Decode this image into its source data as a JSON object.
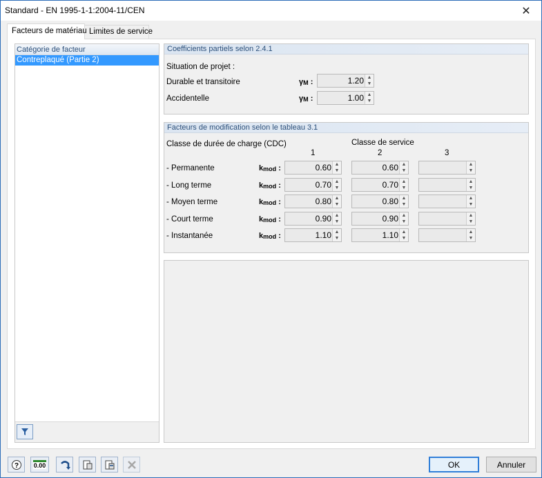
{
  "window": {
    "title": "Standard - EN 1995-1-1:2004-11/CEN",
    "close_icon": "close-icon"
  },
  "tabs": [
    {
      "label": "Facteurs de matériau"
    },
    {
      "label": "Limites de service"
    }
  ],
  "left": {
    "header": "Catégorie de facteur",
    "items": [
      "Contreplaqué (Partie 2)"
    ]
  },
  "partial": {
    "header": "Coefficients partiels selon 2.4.1",
    "situation_label": "Situation de projet :",
    "rows": [
      {
        "label": "Durable et transitoire",
        "symbol": "γ",
        "sub": "M",
        "colon": ":",
        "value": "1.20"
      },
      {
        "label": "Accidentelle",
        "symbol": "γ",
        "sub": "M",
        "colon": ":",
        "value": "1.00"
      }
    ]
  },
  "mod": {
    "header": "Facteurs de modification selon le tableau 3.1",
    "cdc_label": "Classe de durée de charge (CDC)",
    "service_label": "Classe de service",
    "cols": [
      "1",
      "2",
      "3"
    ],
    "rows": [
      {
        "label": "- Permanente",
        "symbol": "k",
        "sub": "mod",
        "colon": ":",
        "v1": "0.60",
        "v2": "0.60",
        "v3": ""
      },
      {
        "label": "- Long terme",
        "symbol": "k",
        "sub": "mod",
        "colon": ":",
        "v1": "0.70",
        "v2": "0.70",
        "v3": ""
      },
      {
        "label": "- Moyen terme",
        "symbol": "k",
        "sub": "mod",
        "colon": ":",
        "v1": "0.80",
        "v2": "0.80",
        "v3": ""
      },
      {
        "label": "- Court terme",
        "symbol": "k",
        "sub": "mod",
        "colon": ":",
        "v1": "0.90",
        "v2": "0.90",
        "v3": ""
      },
      {
        "label": "- Instantanée",
        "symbol": "k",
        "sub": "mod",
        "colon": ":",
        "v1": "1.10",
        "v2": "1.10",
        "v3": ""
      }
    ]
  },
  "toolbar": {
    "zero_label": "0.00"
  },
  "buttons": {
    "ok": "OK",
    "cancel": "Annuler"
  }
}
